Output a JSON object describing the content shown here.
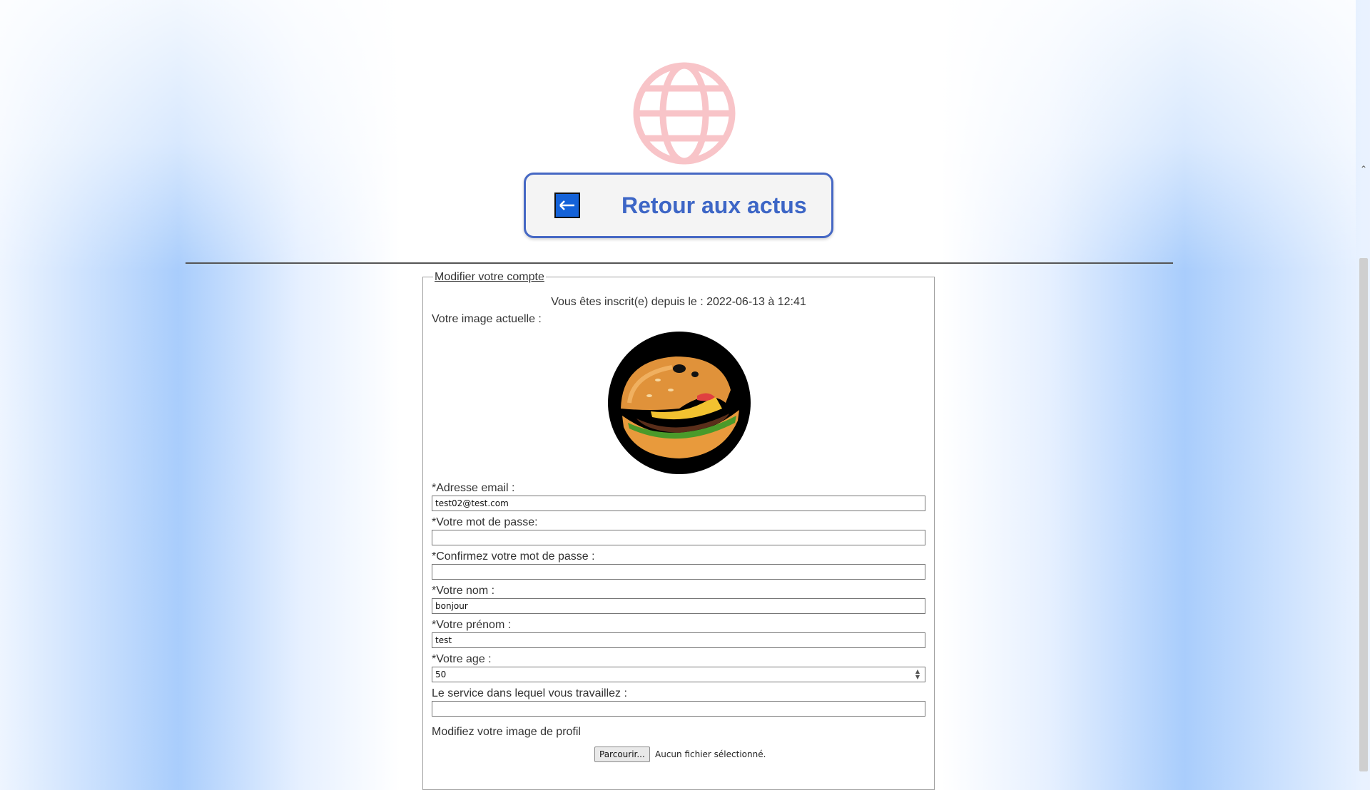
{
  "nav": {
    "back_label": "Retour aux actus",
    "back_arrow": "←",
    "globe_icon": "globe-icon"
  },
  "form": {
    "legend": "Modifier votre compte",
    "registered_since": "Vous êtes inscrit(e) depuis le : 2022-06-13 à 12:41",
    "current_image_label": "Votre image actuelle :",
    "email_label": "*Adresse email :",
    "email_value": "test02@test.com",
    "password_label": "*Votre mot de passe:",
    "password_value": "",
    "confirm_label": "*Confirmez votre mot de passe :",
    "confirm_value": "",
    "lastname_label": "*Votre nom :",
    "lastname_value": "bonjour",
    "firstname_label": "*Votre prénom :",
    "firstname_value": "test",
    "age_label": "*Votre age :",
    "age_value": "50",
    "service_label": "Le service dans lequel vous travaillez :",
    "service_value": "",
    "change_image_label": "Modifiez votre image de profil",
    "browse_label": "Parcourir...",
    "no_file_text": "Aucun fichier sélectionné."
  },
  "colors": {
    "accent": "#3d66c6",
    "globe": "#f8c4c8",
    "arrow_box": "#1462d8"
  }
}
